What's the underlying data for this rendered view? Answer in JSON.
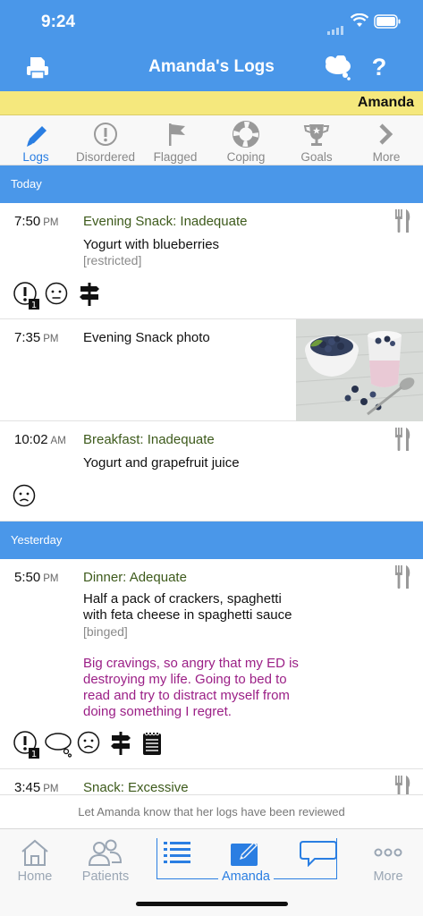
{
  "status": {
    "time": "9:24"
  },
  "nav": {
    "title": "Amanda's Logs",
    "help": "?"
  },
  "patient_name": "Amanda",
  "tabs": [
    {
      "label": "Logs",
      "icon": "pencil-icon",
      "active": true
    },
    {
      "label": "Disordered",
      "icon": "exclamation-circle-icon"
    },
    {
      "label": "Flagged",
      "icon": "flag-icon"
    },
    {
      "label": "Coping",
      "icon": "lifebuoy-icon"
    },
    {
      "label": "Goals",
      "icon": "trophy-icon"
    },
    {
      "label": "More",
      "icon": "chevron-right-icon"
    }
  ],
  "sections": [
    {
      "label": "Today"
    },
    {
      "label": "Yesterday"
    }
  ],
  "entries": [
    {
      "time": "7:50",
      "ampm": "PM",
      "title": "Evening Snack: Inadequate",
      "text": "Yogurt with blueberries",
      "tag": "[restricted]"
    },
    {
      "time": "7:35",
      "ampm": "PM",
      "text": "Evening Snack photo"
    },
    {
      "time": "10:02",
      "ampm": "AM",
      "title": "Breakfast: Inadequate",
      "text": "Yogurt and grapefruit juice"
    },
    {
      "time": "5:50",
      "ampm": "PM",
      "title": "Dinner: Adequate",
      "text_lines": [
        "Half a pack of crackers, spaghetti",
        "with feta cheese in spaghetti sauce"
      ],
      "tag": "[binged]",
      "note_lines": [
        "Big cravings, so angry that my ED is",
        "destroying my life. Going to bed to",
        "read and try to distract myself from",
        "doing something I regret."
      ]
    },
    {
      "time": "3:45",
      "ampm": "PM",
      "title": "Snack: Excessive"
    }
  ],
  "badge_count": "1",
  "review_text": "Let Amanda know that her logs have been reviewed",
  "tabbar": [
    {
      "label": "Home",
      "icon": "home-icon"
    },
    {
      "label": "Patients",
      "icon": "patients-icon"
    },
    {
      "label": "Amanda",
      "icon": "list-icon",
      "selected": true
    },
    {
      "label": "",
      "icon": "compose-icon"
    },
    {
      "label": "",
      "icon": "speech-bubble-icon"
    },
    {
      "label": "More",
      "icon": "more-dots-icon"
    }
  ],
  "colors": {
    "accent": "#4a97e9",
    "name_bar": "#f5e87d",
    "meal_title": "#3d5a1b",
    "note": "#9b1f86"
  }
}
